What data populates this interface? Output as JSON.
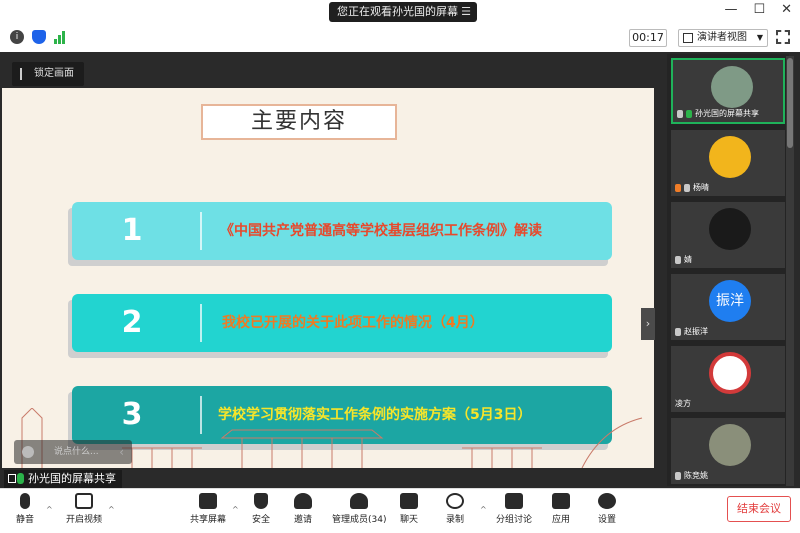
{
  "window": {
    "viewing_label": "您正在观看孙光国的屏幕",
    "menu_glyph": "☰",
    "minimize": "—",
    "maximize": "☐",
    "close": "✕"
  },
  "toolbar": {
    "timer": "00:17",
    "view_mode": "演讲者视图",
    "info_glyph": "i"
  },
  "stage": {
    "pin_label": "锁定画面",
    "chat_placeholder": "说点什么...",
    "chat_arrow": "‹",
    "collapse_glyph": "›",
    "share_label": "孙光国的屏幕共享"
  },
  "slide": {
    "title": "主要内容",
    "rows": [
      {
        "num": "1",
        "text": "《中国共产党普通高等学校基层组织工作条例》解读"
      },
      {
        "num": "2",
        "text": "我校已开展的关于此项工作的情况（4月）"
      },
      {
        "num": "3",
        "text": "学校学习贯彻落实工作条例的实施方案（5月3日）"
      }
    ]
  },
  "participants": [
    {
      "name": "孙光国的屏幕共享",
      "active": true
    },
    {
      "name": "杨晴"
    },
    {
      "name": "婧"
    },
    {
      "name": "赵振洋",
      "avatar_text": "振洋"
    },
    {
      "name": "凌方"
    },
    {
      "name": "陈竞姚"
    }
  ],
  "bottombar": {
    "mute": "静音",
    "video": "开启视频",
    "share": "共享屏幕",
    "security": "安全",
    "invite": "邀请",
    "members": "管理成员(34)",
    "chat": "聊天",
    "record": "录制",
    "breakout": "分组讨论",
    "apps": "应用",
    "settings": "设置",
    "end": "结束会议"
  },
  "colors": {
    "row1": "#6ee0e5",
    "row2": "#22d4d0",
    "row3": "#1ca6a3",
    "end_red": "#e23b3b",
    "active_green": "#1fb25a"
  }
}
